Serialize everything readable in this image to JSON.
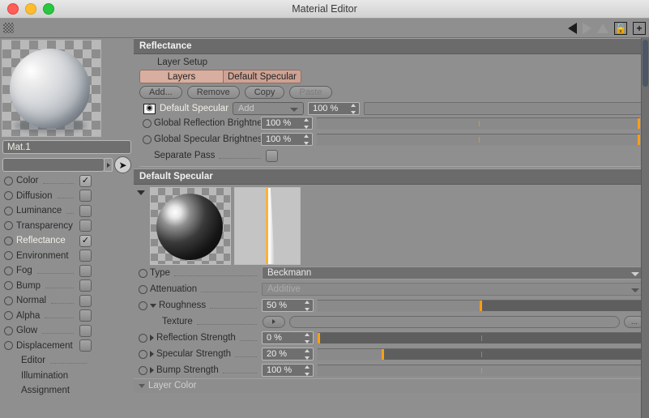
{
  "window": {
    "title": "Material Editor"
  },
  "toolbar": {
    "grip_icon": "checker-grip-icon",
    "back_icon": "arrow-left-icon",
    "forward_icon": "arrow-right-icon",
    "up_icon": "arrow-up-icon",
    "lock_icon": "lock-open-icon",
    "add_icon": "plus-box-icon"
  },
  "material": {
    "name_value": "Mat.1",
    "search_value": "",
    "picker_icon": "cursor-arrow-icon",
    "channels": [
      {
        "label": "Color",
        "checked": true,
        "dotted": true,
        "highlight": false
      },
      {
        "label": "Diffusion",
        "checked": false,
        "dotted": true,
        "highlight": false
      },
      {
        "label": "Luminance",
        "checked": false,
        "dotted": true,
        "highlight": false
      },
      {
        "label": "Transparency",
        "checked": false,
        "dotted": false,
        "highlight": false
      },
      {
        "label": "Reflectance",
        "checked": true,
        "dotted": false,
        "highlight": true
      },
      {
        "label": "Environment",
        "checked": false,
        "dotted": false,
        "highlight": false
      },
      {
        "label": "Fog",
        "checked": false,
        "dotted": true,
        "highlight": false
      },
      {
        "label": "Bump",
        "checked": false,
        "dotted": true,
        "highlight": false
      },
      {
        "label": "Normal",
        "checked": false,
        "dotted": true,
        "highlight": false
      },
      {
        "label": "Alpha",
        "checked": false,
        "dotted": true,
        "highlight": false
      },
      {
        "label": "Glow",
        "checked": false,
        "dotted": true,
        "highlight": false
      },
      {
        "label": "Displacement",
        "checked": false,
        "dotted": false,
        "highlight": false
      }
    ],
    "plain_items": [
      {
        "label": "Editor",
        "dotted": true
      },
      {
        "label": "Illumination",
        "dotted": false
      },
      {
        "label": "Assignment",
        "dotted": false
      }
    ]
  },
  "reflectance": {
    "section_title": "Reflectance",
    "layer_setup_label": "Layer Setup",
    "tabs": [
      {
        "label": "Layers"
      },
      {
        "label": "Default Specular"
      }
    ],
    "buttons": [
      {
        "label": "Add...",
        "enabled": true
      },
      {
        "label": "Remove",
        "enabled": true
      },
      {
        "label": "Copy",
        "enabled": true
      },
      {
        "label": "Paste",
        "enabled": false
      }
    ],
    "layer": {
      "visibility_icon": "eye-icon",
      "name": "Default Specular",
      "blend_mode": "Add",
      "opacity": "100 %"
    },
    "global_rows": [
      {
        "label": "Global Reflection Brightness",
        "value": "100 %",
        "fill_pct": 100
      },
      {
        "label": "Global Specular Brightness",
        "value": "100 %",
        "fill_pct": 100
      }
    ],
    "separate_pass": {
      "label": "Separate Pass",
      "checked": false
    }
  },
  "default_specular": {
    "section_title": "Default Specular",
    "preview_icon": "specular-sphere-preview",
    "curve_icon": "brdf-curve-graph",
    "type_row": {
      "label": "Type",
      "value": "Beckmann"
    },
    "attenuation_row": {
      "label": "Attenuation",
      "value": "Additive"
    },
    "roughness_row": {
      "label": "Roughness",
      "value": "50 %",
      "fill_pct": 50
    },
    "texture_row": {
      "label": "Texture",
      "value": "",
      "more_label": "..."
    },
    "strength_rows": [
      {
        "label": "Reflection Strength",
        "value": "0 %",
        "fill_pct": 0
      },
      {
        "label": "Specular Strength",
        "value": "20 %",
        "fill_pct": 20
      },
      {
        "label": "Bump Strength",
        "value": "100 %",
        "fill_pct": 100
      }
    ],
    "layer_color_label": "Layer Color"
  },
  "colors": {
    "accent_orange": "#ff9d17",
    "tab_salmon": "#cda294",
    "panel_gray": "#8f8f8f",
    "section_gray": "#6b6b6b"
  }
}
